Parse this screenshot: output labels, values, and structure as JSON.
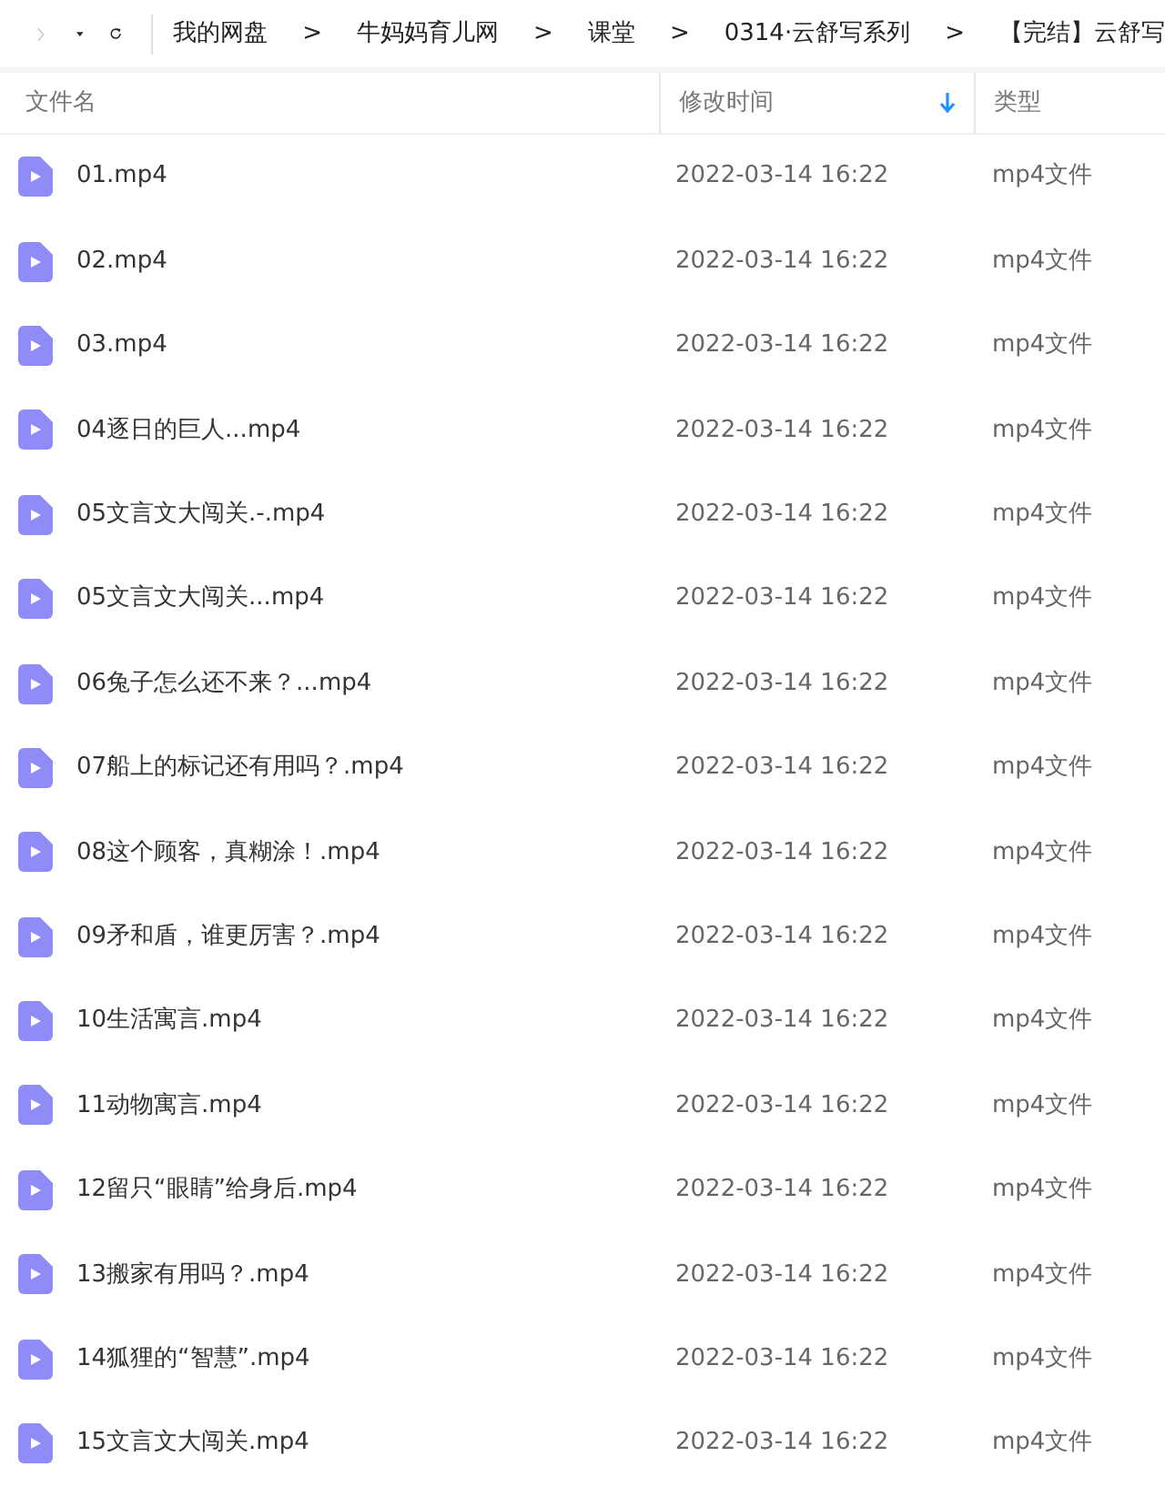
{
  "toolbar": {
    "forward_disabled": true,
    "breadcrumbs": [
      {
        "label": "我的网盘"
      },
      {
        "label": "牛妈妈育儿网"
      },
      {
        "label": "课堂"
      },
      {
        "label": "0314·云舒写系列"
      },
      {
        "label": "【完结】云舒写"
      }
    ],
    "separator": ">"
  },
  "table": {
    "columns": [
      {
        "label": "文件名",
        "sorted": false
      },
      {
        "label": "修改时间",
        "sorted": true
      },
      {
        "label": "类型",
        "sorted": false
      }
    ],
    "rows": [
      {
        "name": "01.mp4",
        "modified": "2022-03-14 16:22",
        "type": "mp4文件"
      },
      {
        "name": "02.mp4",
        "modified": "2022-03-14 16:22",
        "type": "mp4文件"
      },
      {
        "name": "03.mp4",
        "modified": "2022-03-14 16:22",
        "type": "mp4文件"
      },
      {
        "name": "04逐日的巨人...mp4",
        "modified": "2022-03-14 16:22",
        "type": "mp4文件"
      },
      {
        "name": "05文言文大闯关.-.mp4",
        "modified": "2022-03-14 16:22",
        "type": "mp4文件"
      },
      {
        "name": "05文言文大闯关...mp4",
        "modified": "2022-03-14 16:22",
        "type": "mp4文件"
      },
      {
        "name": "06兔子怎么还不来？...mp4",
        "modified": "2022-03-14 16:22",
        "type": "mp4文件"
      },
      {
        "name": "07船上的标记还有用吗？.mp4",
        "modified": "2022-03-14 16:22",
        "type": "mp4文件"
      },
      {
        "name": "08这个顾客，真糊涂！.mp4",
        "modified": "2022-03-14 16:22",
        "type": "mp4文件"
      },
      {
        "name": "09矛和盾，谁更厉害？.mp4",
        "modified": "2022-03-14 16:22",
        "type": "mp4文件"
      },
      {
        "name": "10生活寓言.mp4",
        "modified": "2022-03-14 16:22",
        "type": "mp4文件"
      },
      {
        "name": "11动物寓言.mp4",
        "modified": "2022-03-14 16:22",
        "type": "mp4文件"
      },
      {
        "name": "12留只“眼睛”给身后.mp4",
        "modified": "2022-03-14 16:22",
        "type": "mp4文件"
      },
      {
        "name": "13搬家有用吗？.mp4",
        "modified": "2022-03-14 16:22",
        "type": "mp4文件"
      },
      {
        "name": "14狐狸的“智慧”.mp4",
        "modified": "2022-03-14 16:22",
        "type": "mp4文件"
      },
      {
        "name": "15文言文大闯关.mp4",
        "modified": "2022-03-14 16:22",
        "type": "mp4文件"
      }
    ]
  }
}
